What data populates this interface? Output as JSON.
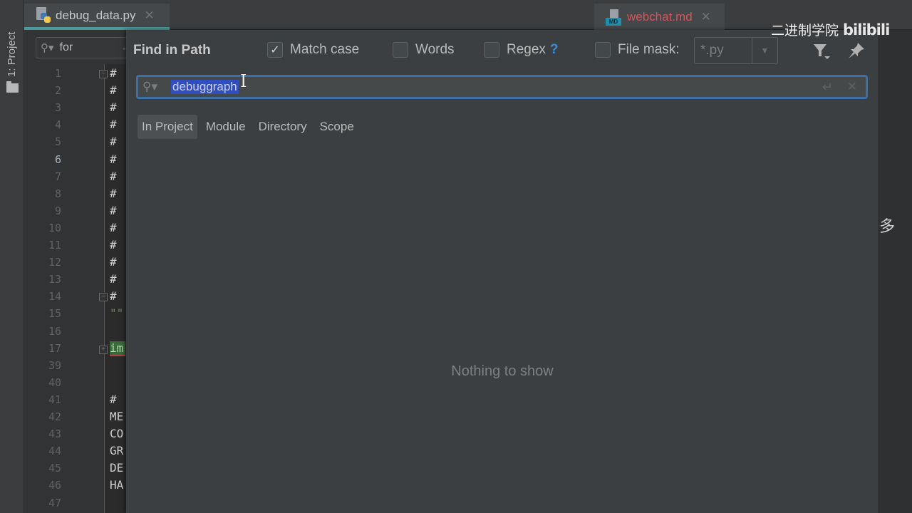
{
  "toolstrip": {
    "project_label": "1: Project"
  },
  "tabs": [
    {
      "title": "debug_data.py",
      "icon": "python-file-icon",
      "active": true
    },
    {
      "title": "webchat.md",
      "icon": "markdown-file-icon",
      "active": false
    }
  ],
  "editor": {
    "search_value": "for",
    "lines": [
      {
        "n": "1",
        "code": "#"
      },
      {
        "n": "2",
        "code": "#"
      },
      {
        "n": "3",
        "code": "#"
      },
      {
        "n": "4",
        "code": "#"
      },
      {
        "n": "5",
        "code": "#"
      },
      {
        "n": "6",
        "code": "#"
      },
      {
        "n": "7",
        "code": "#"
      },
      {
        "n": "8",
        "code": "#"
      },
      {
        "n": "9",
        "code": "#"
      },
      {
        "n": "10",
        "code": "#"
      },
      {
        "n": "11",
        "code": "#"
      },
      {
        "n": "12",
        "code": "#"
      },
      {
        "n": "13",
        "code": "#"
      },
      {
        "n": "14",
        "code": "#"
      },
      {
        "n": "15",
        "code": "\"\"\""
      },
      {
        "n": "16",
        "code": ""
      },
      {
        "n": "17",
        "code": "im"
      },
      {
        "n": "39",
        "code": ""
      },
      {
        "n": "40",
        "code": ""
      },
      {
        "n": "41",
        "code": "#"
      },
      {
        "n": "42",
        "code": "ME"
      },
      {
        "n": "43",
        "code": "CO"
      },
      {
        "n": "44",
        "code": "GR"
      },
      {
        "n": "45",
        "code": "DE"
      },
      {
        "n": "46",
        "code": "HA"
      },
      {
        "n": "47",
        "code": ""
      }
    ],
    "current_line": "6"
  },
  "dialog": {
    "title": "Find in Path",
    "options": {
      "match_case": {
        "label": "Match case",
        "checked": true
      },
      "words": {
        "label": "Words",
        "checked": false
      },
      "regex": {
        "label": "Regex",
        "checked": false,
        "help": "?"
      },
      "file_mask": {
        "label": "File mask:",
        "checked": false,
        "value": "*.py"
      }
    },
    "search": {
      "query": "debuggraph"
    },
    "scopes": [
      {
        "label": "In Project",
        "active": true
      },
      {
        "label": "Module",
        "active": false
      },
      {
        "label": "Directory",
        "active": false
      },
      {
        "label": "Scope",
        "active": false
      }
    ],
    "empty_message": "Nothing to show"
  },
  "watermark": {
    "text": "二进制学院",
    "brand": "bilibili"
  },
  "side_text": "多",
  "colors": {
    "accent_blue": "#3c6ea8",
    "selection": "#2f4fc0",
    "tab_underline": "#4a9a9a",
    "md_tab_text": "#d2555c",
    "help_blue": "#3b8ddb"
  }
}
